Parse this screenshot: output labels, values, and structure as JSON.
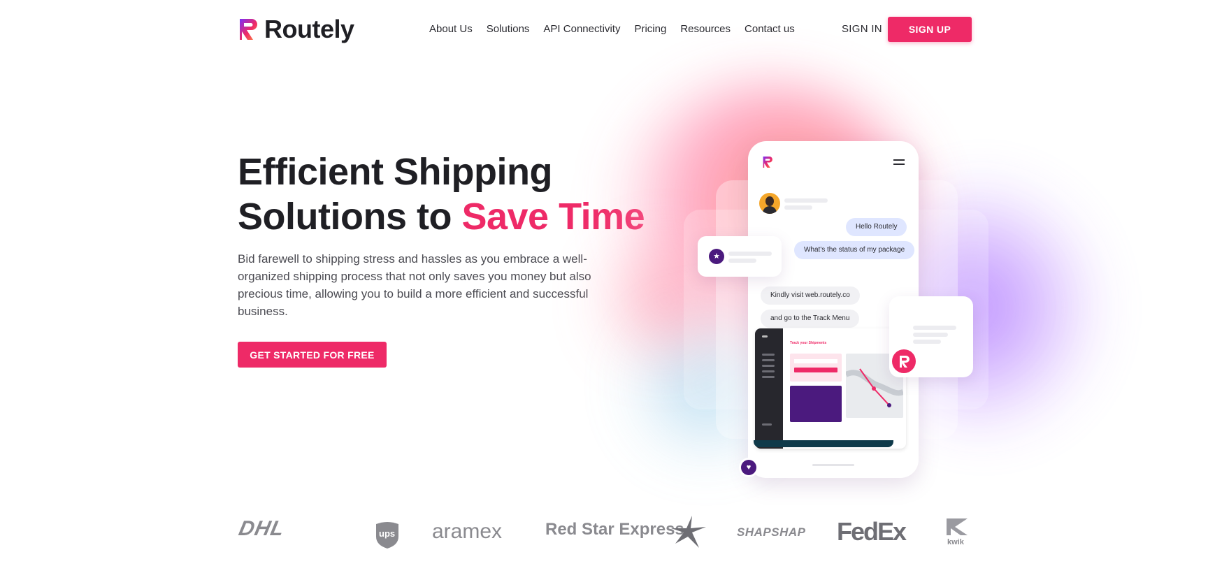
{
  "brand": {
    "name": "Routely",
    "accent": "#ee2a67",
    "purple": "#4b1a7e"
  },
  "nav": {
    "items": [
      "About Us",
      "Solutions",
      "API Connectivity",
      "Pricing",
      "Resources",
      "Contact us"
    ],
    "signin": "SIGN IN",
    "signup": "SIGN UP"
  },
  "hero": {
    "title_line1": "Efficient Shipping",
    "title_line2_start": "Solutions to ",
    "title_accent": "Save Time",
    "description": "Bid farewell to shipping stress and hassles as you embrace a well-organized shipping process that not only saves you money but also precious time, allowing you to build a more efficient and successful business.",
    "cta": "GET STARTED FOR FREE"
  },
  "phone": {
    "messages_out": [
      "Hello Routely",
      "What's the status of my package"
    ],
    "messages_in": [
      "Kindly visit web.routely.co",
      "and go to the Track Menu"
    ],
    "dashboard_title": "Track your Shipments",
    "icons": {
      "star": "star-icon",
      "heart": "heart-icon",
      "menu": "menu-icon"
    }
  },
  "partners": {
    "logos": [
      "DHL",
      "ups",
      "aramex",
      "Red Star Express",
      "SHAPSHAP",
      "FedEx",
      "kwik"
    ]
  }
}
